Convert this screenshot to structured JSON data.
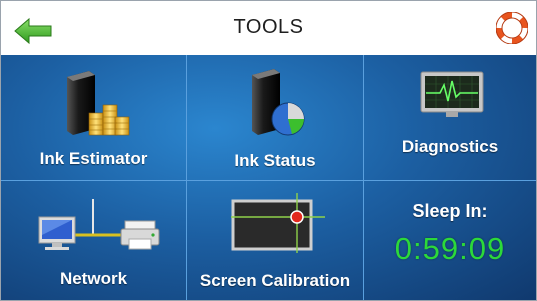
{
  "header": {
    "title": "TOOLS",
    "back_icon": "back-arrow-icon",
    "help_icon": "lifebuoy-icon"
  },
  "tiles": {
    "ink_estimator": {
      "label": "Ink Estimator",
      "icon": "ink-cartridge-coins-icon"
    },
    "ink_status": {
      "label": "Ink Status",
      "icon": "ink-cartridge-pie-icon"
    },
    "diagnostics": {
      "label": "Diagnostics",
      "icon": "heartbeat-monitor-icon"
    },
    "network": {
      "label": "Network",
      "icon": "computer-printer-network-icon"
    },
    "screen_calibration": {
      "label": "Screen Calibration",
      "icon": "crosshair-screen-icon"
    }
  },
  "sleep": {
    "title": "Sleep In:",
    "time": "0:59:09"
  },
  "colors": {
    "accent_green": "#2cd93a",
    "tile_blue": "#1c5fa2",
    "arrow_green": "#3fae2a",
    "lifebuoy_orange": "#e8541e"
  }
}
